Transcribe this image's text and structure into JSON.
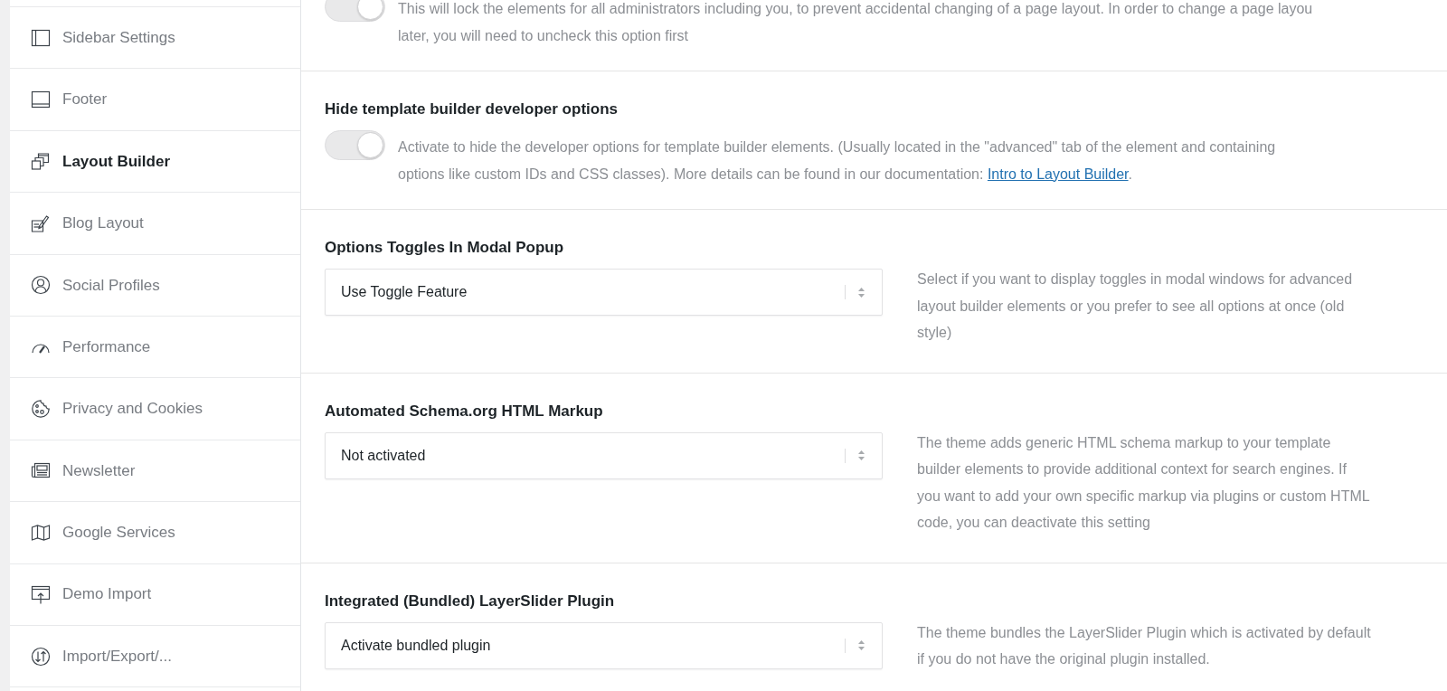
{
  "sidebar": {
    "items": [
      {
        "label": "Sidebar Settings",
        "selected": false
      },
      {
        "label": "Footer",
        "selected": false
      },
      {
        "label": "Layout Builder",
        "selected": true
      },
      {
        "label": "Blog Layout",
        "selected": false
      },
      {
        "label": "Social Profiles",
        "selected": false
      },
      {
        "label": "Performance",
        "selected": false
      },
      {
        "label": "Privacy and Cookies",
        "selected": false
      },
      {
        "label": "Newsletter",
        "selected": false
      },
      {
        "label": "Google Services",
        "selected": false
      },
      {
        "label": "Demo Import",
        "selected": false
      },
      {
        "label": "Import/Export/...",
        "selected": false
      }
    ]
  },
  "sections": [
    {
      "kind": "toggle",
      "toggle": {
        "on": true
      },
      "description_lines": [
        "This will lock the elements for all administrators including you, to prevent accidental changing of a page layout. In order to change a page layou",
        "later, you will need to uncheck this option first"
      ]
    },
    {
      "kind": "toggle",
      "heading": "Hide template builder developer options",
      "toggle": {
        "on": true
      },
      "description_lines": [
        "Activate to hide the developer options for template builder elements. (Usually located in the \"advanced\" tab of the element and containing",
        "options like custom IDs and CSS classes). More details can be found in our documentation:"
      ],
      "link": "Intro to Layout Builder",
      "link_suffix": "."
    },
    {
      "kind": "select",
      "heading": "Options Toggles In Modal Popup",
      "select": {
        "value": "Use Toggle Feature"
      },
      "description_lines": [
        "Select if you want to display toggles in modal windows for advanced",
        "layout builder elements or you prefer to see all options at once (old",
        "style)"
      ]
    },
    {
      "kind": "select",
      "heading": "Automated Schema.org HTML Markup",
      "select": {
        "value": "Not activated"
      },
      "description_lines": [
        "The theme adds generic HTML schema markup to your template",
        "builder elements to provide additional context for search engines. If",
        "you want to add your own specific markup via plugins or custom HTML",
        "code, you can deactivate this setting"
      ]
    },
    {
      "kind": "select",
      "heading": "Integrated (Bundled) LayerSlider Plugin",
      "select": {
        "value": "Activate bundled plugin"
      },
      "description_lines": [
        "The theme bundles the LayerSlider Plugin which is activated by default",
        "if you do not have the original plugin installed."
      ]
    }
  ]
}
